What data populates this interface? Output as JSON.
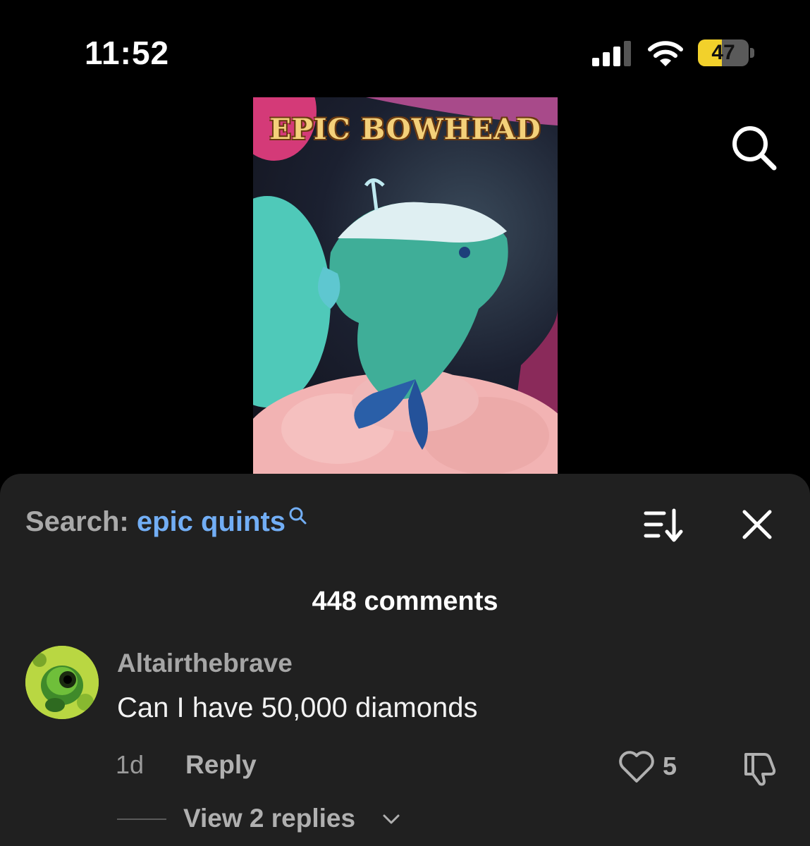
{
  "status_bar": {
    "time": "11:52",
    "battery": "47",
    "battery_level": 0.47,
    "icons": [
      "signal-icon",
      "wifi-icon",
      "battery-icon"
    ]
  },
  "video": {
    "title": "EPIC BOWHEAD"
  },
  "comments_sheet": {
    "search_label": "Search:",
    "search_query": "epic quints",
    "comment_count": "448 comments",
    "icons": [
      "search-icon",
      "sort-icon",
      "close-icon"
    ]
  },
  "comment": {
    "username": "Altairthebrave",
    "text": "Can I have 50,000 diamonds",
    "timestamp": "1d",
    "reply_label": "Reply",
    "likes": "5",
    "view_replies": "View 2 replies",
    "icons": [
      "heart-icon",
      "dislike-icon",
      "chevron-down-icon"
    ]
  },
  "colors": {
    "background": "#000000",
    "sheet": "#202020",
    "accent_link": "#72aef5",
    "battery_fill": "#f2d12b"
  }
}
